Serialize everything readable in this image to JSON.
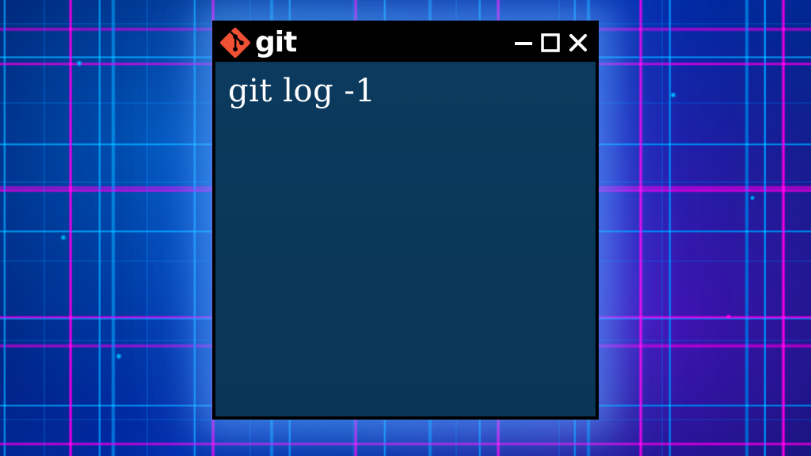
{
  "window": {
    "title": "git",
    "logo_name": "git-logo-icon",
    "controls": {
      "minimize": "minimize-icon",
      "maximize": "maximize-icon",
      "close": "close-icon"
    }
  },
  "terminal": {
    "command": "git log -1"
  },
  "colors": {
    "titlebar_bg": "#000000",
    "terminal_bg": "#0b3a5e",
    "text": "#ffffff",
    "git_brand": "#f05033"
  }
}
